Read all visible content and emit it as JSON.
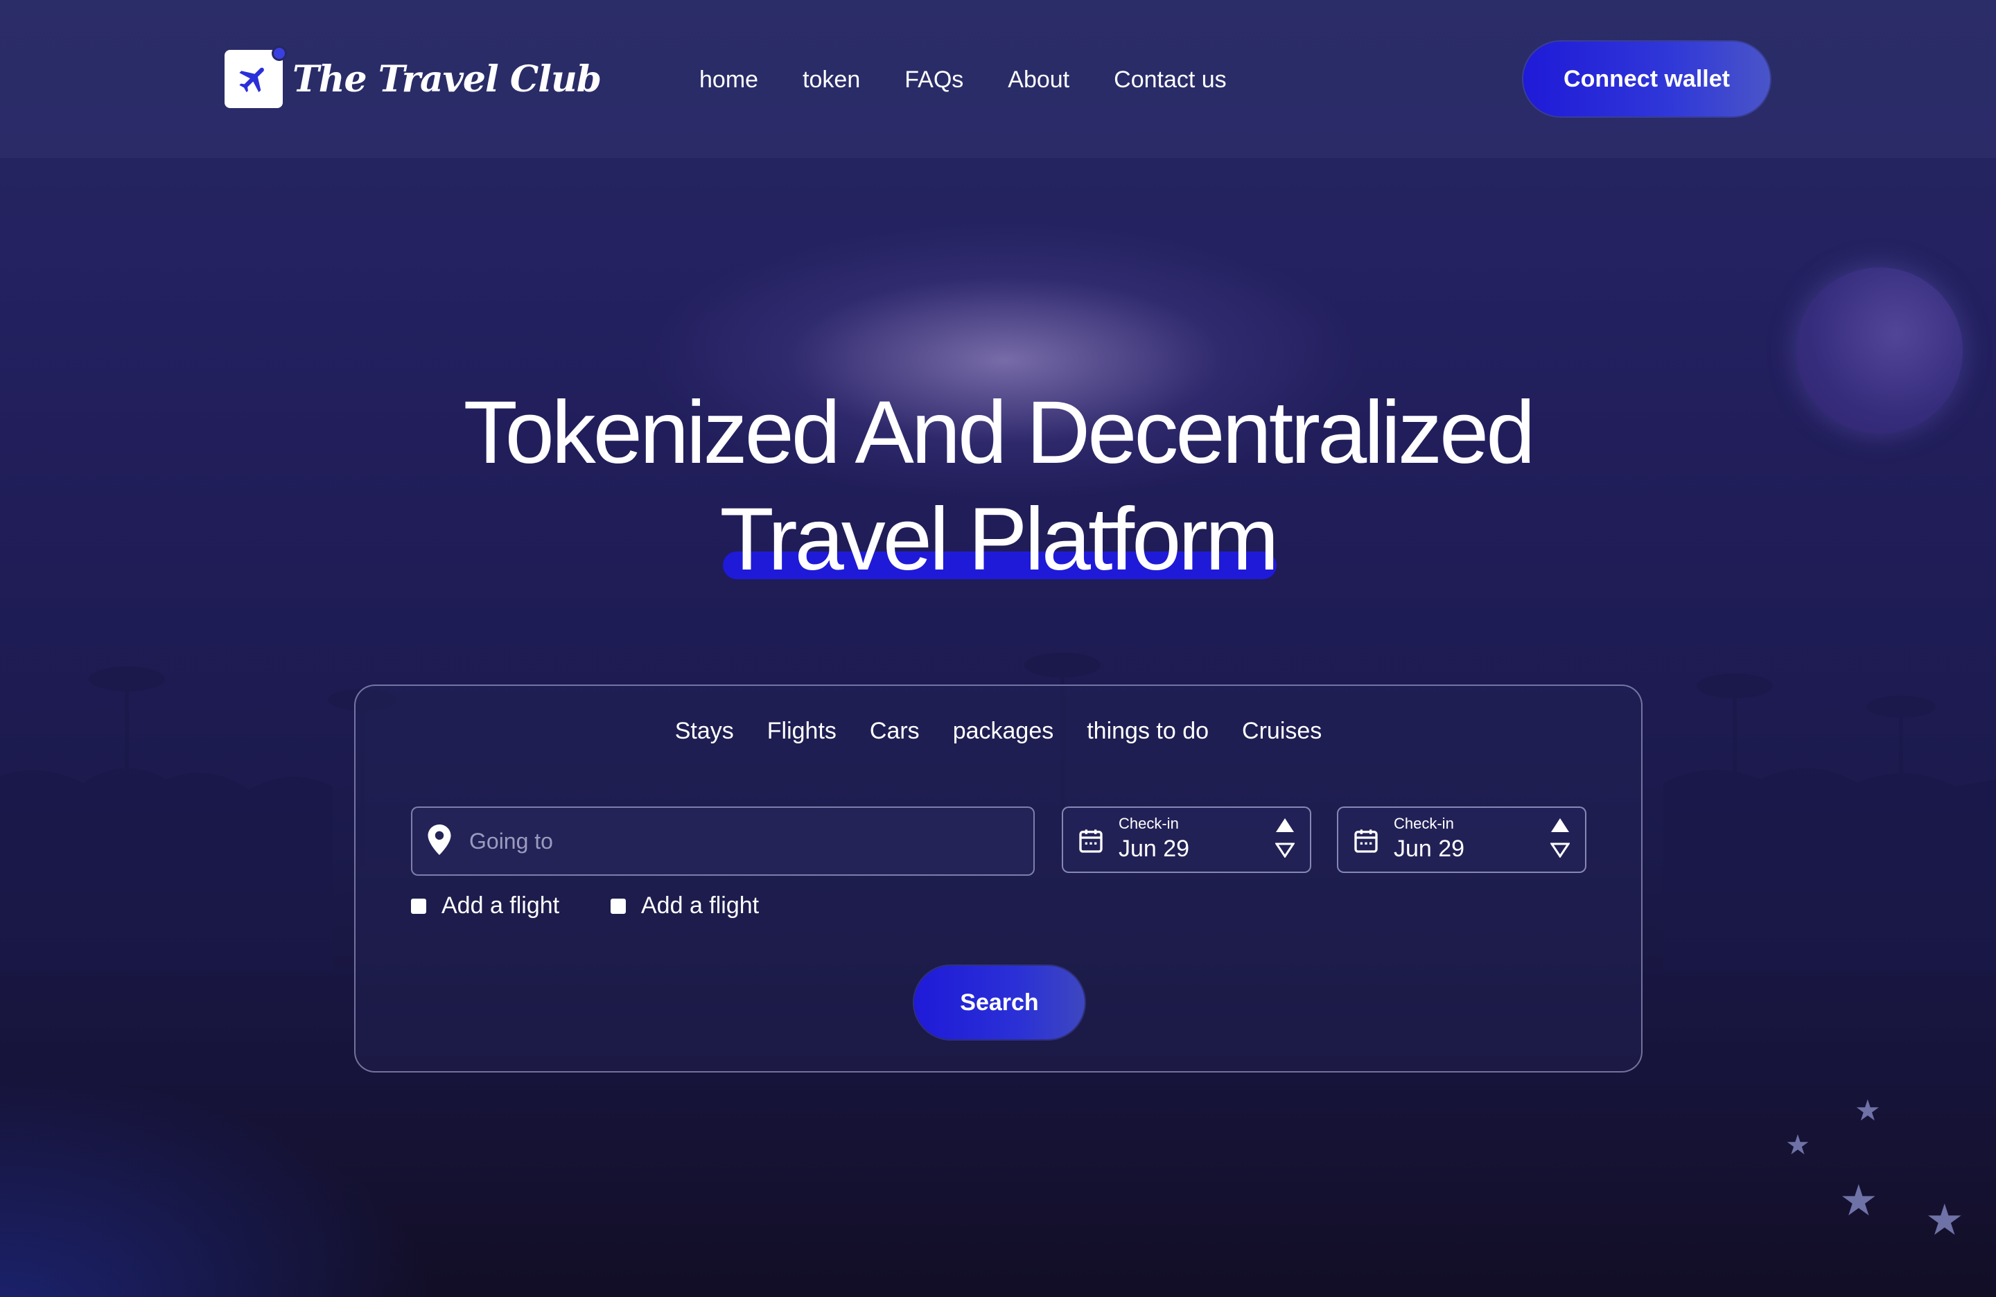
{
  "brand": {
    "name": "The Travel Club"
  },
  "nav": {
    "items": [
      {
        "label": "home"
      },
      {
        "label": "token"
      },
      {
        "label": "FAQs"
      },
      {
        "label": "About"
      },
      {
        "label": "Contact us"
      }
    ]
  },
  "header": {
    "connect_label": "Connect wallet"
  },
  "hero": {
    "line1": "Tokenized And Decentralized",
    "line2": "Travel Platform"
  },
  "search_panel": {
    "tabs": [
      {
        "label": "Stays"
      },
      {
        "label": "Flights"
      },
      {
        "label": "Cars"
      },
      {
        "label": "packages"
      },
      {
        "label": "things to do"
      },
      {
        "label": "Cruises"
      }
    ],
    "destination": {
      "placeholder": "Going to",
      "icon": "map-pin-icon"
    },
    "dates": [
      {
        "label": "Check-in",
        "value": "Jun 29",
        "icon": "calendar-icon"
      },
      {
        "label": "Check-in",
        "value": "Jun 29",
        "icon": "calendar-icon"
      }
    ],
    "checkboxes": [
      {
        "label": "Add a flight",
        "checked": false
      },
      {
        "label": "Add a flight",
        "checked": false
      }
    ],
    "search_label": "Search"
  },
  "colors": {
    "accent": "#1f1ad8",
    "background": "#1f1c56",
    "text": "#ffffff"
  }
}
